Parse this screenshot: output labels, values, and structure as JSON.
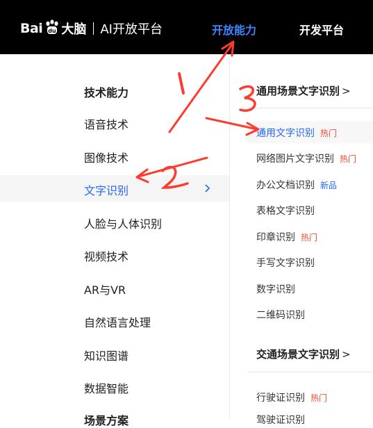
{
  "header": {
    "logo": {
      "brand": "Bai",
      "dana": "大脑",
      "subtitle": "AI开放平台"
    },
    "nav": [
      {
        "label": "开放能力",
        "active": true
      },
      {
        "label": "开发平台",
        "active": false
      }
    ]
  },
  "left_menu": {
    "heading": "技术能力",
    "items": [
      "语音技术",
      "图像技术",
      "文字识别",
      "人脸与人体识别",
      "视频技术",
      "AR与VR",
      "自然语言处理",
      "知识图谱",
      "数据智能",
      "场景方案"
    ],
    "active_index": 2
  },
  "sub_menu": {
    "groups": [
      {
        "title": "通用场景文字识别",
        "chevron": ">",
        "items": [
          {
            "label": "通用文字识别",
            "badge": "热门",
            "badge_type": "hot",
            "active": true
          },
          {
            "label": "网络图片文字识别",
            "badge": "热门",
            "badge_type": "hot"
          },
          {
            "label": "办公文档识别",
            "badge": "新品",
            "badge_type": "new"
          },
          {
            "label": "表格文字识别"
          },
          {
            "label": "印章识别",
            "badge": "热门",
            "badge_type": "hot"
          },
          {
            "label": "手写文字识别"
          },
          {
            "label": "数字识别"
          },
          {
            "label": "二维码识别"
          }
        ]
      },
      {
        "title": "交通场景文字识别",
        "chevron": ">",
        "items": [
          {
            "label": "行驶证识别",
            "badge": "热门",
            "badge_type": "hot"
          },
          {
            "label": "驾驶证识别"
          }
        ]
      }
    ]
  },
  "colors": {
    "accent": "#2468f2",
    "nav_active": "#3b86ff",
    "hot": "#f5492e",
    "annotation": "#ff3b30"
  }
}
